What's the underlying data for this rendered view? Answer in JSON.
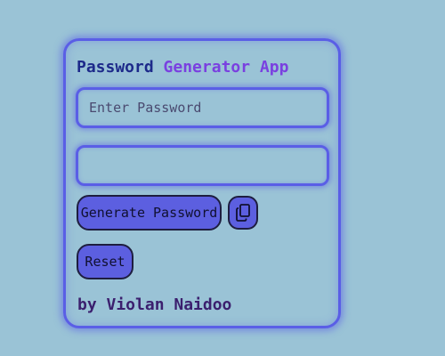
{
  "app": {
    "title_part1": "Password",
    "title_part2": "Generator App",
    "author": "by Violan Naidoo"
  },
  "inputs": {
    "password_placeholder": "Enter Password",
    "password_value": "",
    "generated_value": ""
  },
  "buttons": {
    "generate_label": "Generate Password",
    "copy_icon": "copy-icon",
    "reset_label": "Reset"
  },
  "colors": {
    "background": "#9ac3d6",
    "accent": "#5a5ee6",
    "title_primary": "#1d2a8a",
    "title_secondary": "#7a40e0",
    "author": "#3b1f6e"
  }
}
